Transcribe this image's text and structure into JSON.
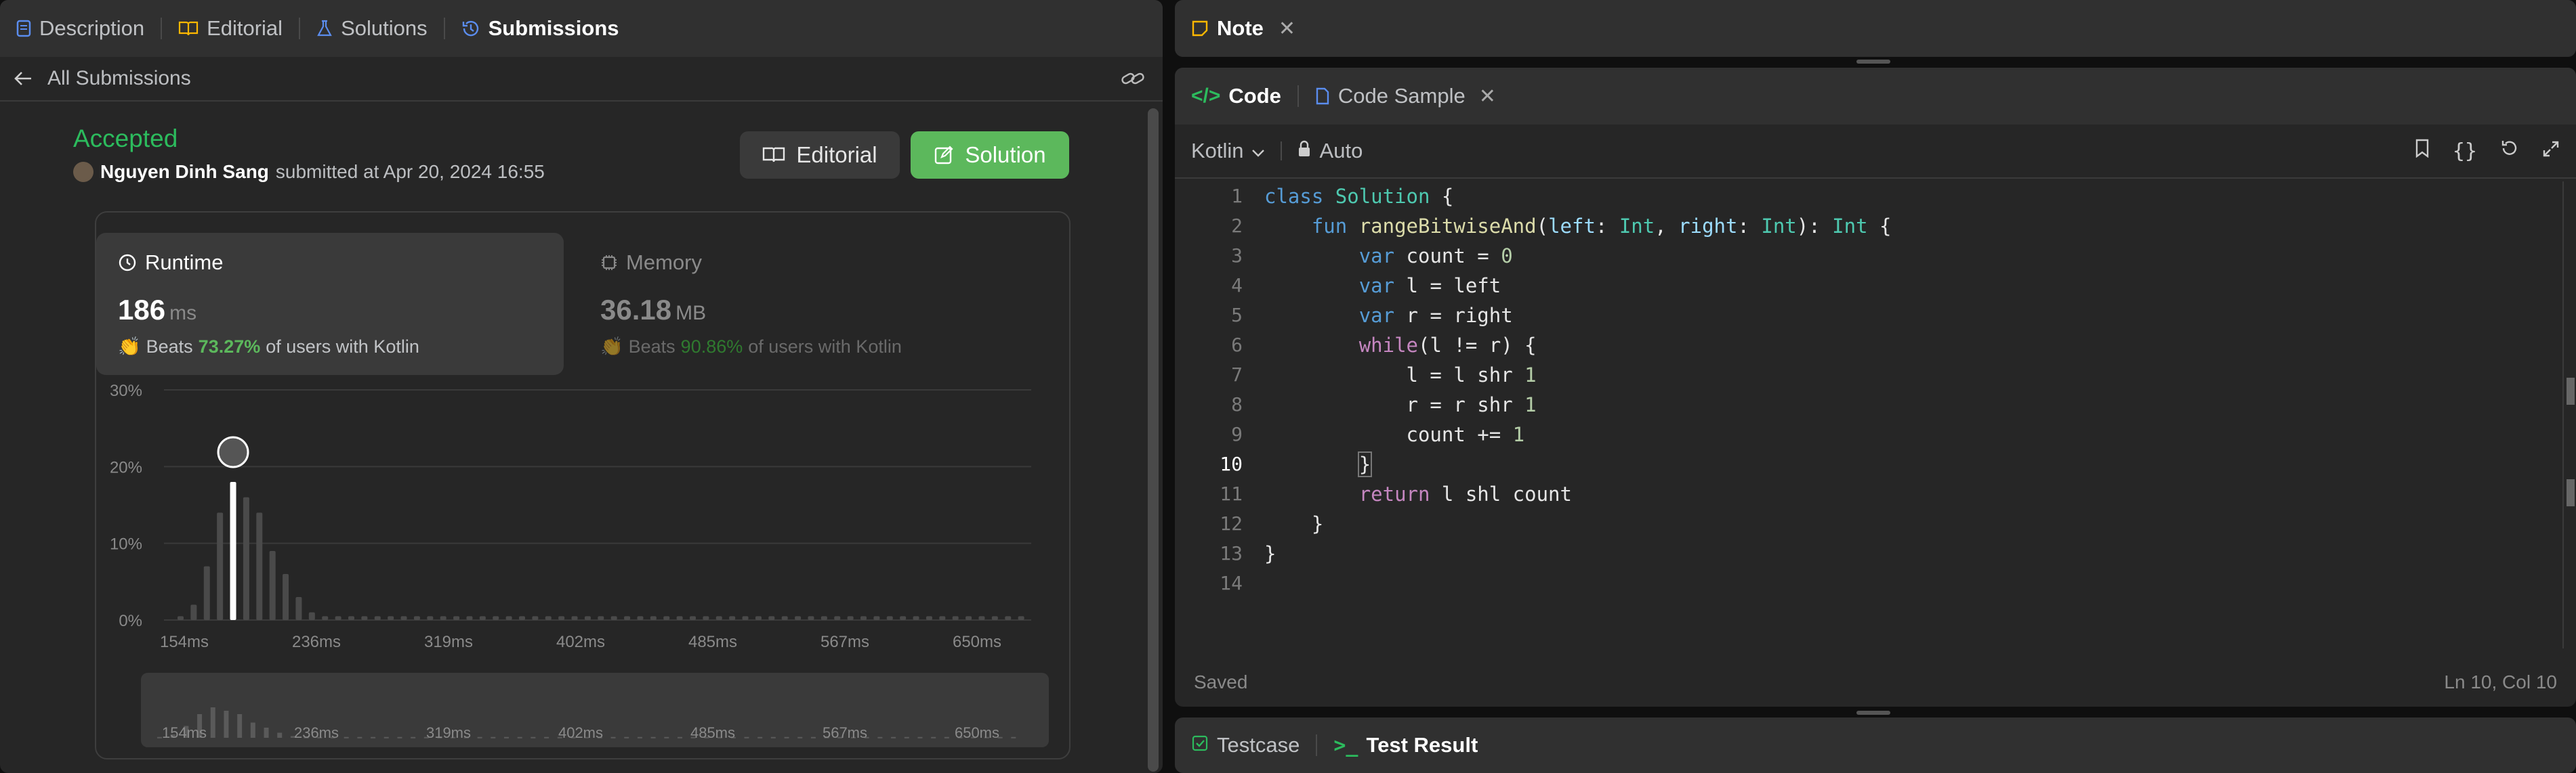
{
  "left_tabs": [
    {
      "label": "Description",
      "icon": "description-icon"
    },
    {
      "label": "Editorial",
      "icon": "book-icon"
    },
    {
      "label": "Solutions",
      "icon": "flask-icon"
    },
    {
      "label": "Submissions",
      "icon": "history-icon"
    }
  ],
  "back_label": "All Submissions",
  "result": {
    "status": "Accepted",
    "user": "Nguyen Dinh Sang",
    "submitted_text": "submitted at Apr 20, 2024 16:55",
    "editorial_btn": "Editorial",
    "solution_btn": "Solution"
  },
  "runtime": {
    "label": "Runtime",
    "value": "186",
    "unit": "ms",
    "beats_prefix": "Beats",
    "beats_pct": "73.27%",
    "beats_suffix": "of users with Kotlin"
  },
  "memory": {
    "label": "Memory",
    "value": "36.18",
    "unit": "MB",
    "beats_prefix": "Beats",
    "beats_pct": "90.86%",
    "beats_suffix": "of users with Kotlin"
  },
  "chart_data": {
    "type": "bar",
    "y_ticks": [
      "30%",
      "20%",
      "10%",
      "0%"
    ],
    "ylim": [
      0,
      30
    ],
    "x_ticks": [
      "154ms",
      "236ms",
      "319ms",
      "402ms",
      "485ms",
      "567ms",
      "650ms"
    ],
    "values": [
      0.5,
      2,
      7,
      14,
      18,
      16,
      14,
      9,
      6,
      3,
      1,
      0.5,
      0.5,
      0.5,
      0.5,
      0.5,
      0.5,
      0.5,
      0.5,
      0.5,
      0.5,
      0.5,
      0.5,
      0.5,
      0.5,
      0.5,
      0.5,
      0.5,
      0.5,
      0.5,
      0.5,
      0.5,
      0.5,
      0.5,
      0.5,
      0.5,
      0.5,
      0.5,
      0.5,
      0.5,
      0.5,
      0.5,
      0.5,
      0.5,
      0.5,
      0.5,
      0.5,
      0.5,
      0.5,
      0.5,
      0.5,
      0.5,
      0.5,
      0.5,
      0.5,
      0.5,
      0.5,
      0.5,
      0.5,
      0.5,
      0.5,
      0.5,
      0.5,
      0.5,
      0.5
    ],
    "highlight_index": 4,
    "colors": {
      "bar": "#4a4a4a",
      "highlight": "#ffffff",
      "grid": "#3a3a3a"
    }
  },
  "note_tab": "Note",
  "code_tabs": {
    "code": "Code",
    "sample": "Code Sample"
  },
  "language": "Kotlin",
  "auto_label": "Auto",
  "line_numbers": [
    "1",
    "2",
    "3",
    "4",
    "5",
    "6",
    "7",
    "8",
    "9",
    "10",
    "11",
    "12",
    "13",
    "14"
  ],
  "status": {
    "saved": "Saved",
    "position": "Ln 10, Col 10"
  },
  "bottom_tabs": {
    "testcase": "Testcase",
    "result": "Test Result"
  },
  "colors": {
    "accent_green": "#5cb85c",
    "accepted": "#2cbb5d",
    "panel": "#262626"
  }
}
